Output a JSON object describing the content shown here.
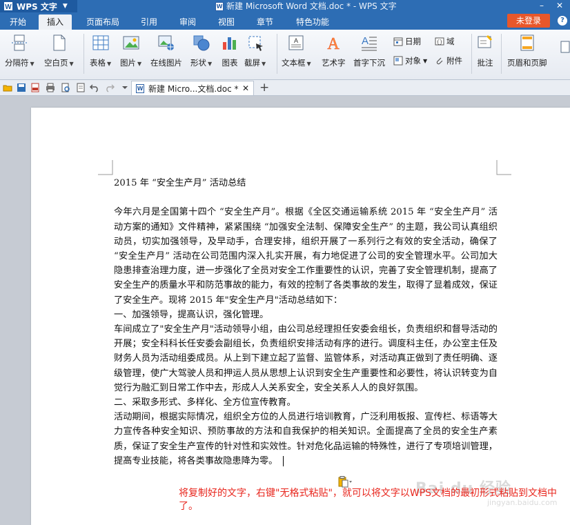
{
  "titlebar": {
    "app_menu": "WPS 文字",
    "document_title": "新建 Microsoft Word 文档.doc * - WPS 文字"
  },
  "menu": {
    "tabs": [
      "开始",
      "插入",
      "页面布局",
      "引用",
      "审阅",
      "视图",
      "章节",
      "特色功能"
    ],
    "active_tab": "插入",
    "login_button": "未登录"
  },
  "ribbon": {
    "buttons": [
      {
        "label": "分隔符",
        "icon": "page-break-icon",
        "dropdown": true
      },
      {
        "label": "空白页",
        "icon": "blank-page-icon",
        "dropdown": true
      },
      {
        "label": "表格",
        "icon": "table-icon",
        "dropdown": true
      },
      {
        "label": "图片",
        "icon": "picture-icon",
        "dropdown": true
      },
      {
        "label": "在线图片",
        "icon": "online-picture-icon",
        "dropdown": false
      },
      {
        "label": "形状",
        "icon": "shapes-icon",
        "dropdown": true
      },
      {
        "label": "图表",
        "icon": "chart-icon",
        "dropdown": false
      },
      {
        "label": "截屏",
        "icon": "screenshot-icon",
        "dropdown": true
      },
      {
        "label": "文本框",
        "icon": "textbox-icon",
        "dropdown": true
      },
      {
        "label": "艺术字",
        "icon": "wordart-icon",
        "dropdown": false
      },
      {
        "label": "首字下沉",
        "icon": "drop-cap-icon",
        "dropdown": false
      },
      {
        "label": "批注",
        "icon": "comment-icon",
        "dropdown": false
      },
      {
        "label": "页眉和页脚",
        "icon": "header-footer-icon",
        "dropdown": false
      }
    ],
    "small_buttons": [
      {
        "label": "日期",
        "icon": "date-icon"
      },
      {
        "label": "域",
        "icon": "field-icon"
      },
      {
        "label": "对象",
        "icon": "object-icon"
      },
      {
        "label": "附件",
        "icon": "attachment-icon"
      }
    ]
  },
  "doc_tab": {
    "label": "新建 Micro...文档.doc *"
  },
  "document": {
    "title": "2015 年 “安全生产月” 活动总结",
    "paragraphs": [
      "今年六月是全国第十四个 “安全生产月”。根据《全区交通运输系统 2015 年 “安全生产月” 活动方案的通知》文件精神，紧紧围绕 “加强安全法制、保障安全生产” 的主题，我公司认真组织动员，切实加强领导，及早动手，合理安排，组织开展了一系列行之有效的安全活动，确保了 “安全生产月” 活动在公司范围内深入扎实开展，有力地促进了公司的安全管理水平。公司加大隐患排查治理力度，进一步强化了全员对安全工作重要性的认识，完善了安全管理机制，提高了安全生产的质量水平和防范事故的能力，有效的控制了各类事故的发生，取得了显着成效，保证了安全生产。现将 2015 年\"安全生产月\"活动总结如下：",
      "一、加强领导，提高认识，强化管理。",
      "车间成立了\"安全生产月\"活动领导小组，由公司总经理担任安委会组长，负责组织和督导活动的开展；安全科科长任安委会副组长，负责组织安排活动有序的进行。调度科主任，办公室主任及财务人员为活动组委成员。从上到下建立起了监督、监管体系，对活动真正做到了责任明确、逐级管理，使广大驾驶人员和押运人员从思想上认识到安全生产重要性和必要性，将认识转变为自觉行为融汇到日常工作中去，形成人人关系安全，安全关系人人的良好氛围。",
      "二、采取多形式、多样化、全方位宣传教育。",
      "活动期间，根据实际情况，组织全方位的人员进行培训教育，广泛利用板报、宣传栏、标语等大力宣传各种安全知识、预防事故的方法和自我保护的相关知识。全面提高了全员的安全生产素质，保证了安全生产宣传的针对性和实效性。针对危化品运输的特殊性，进行了专项培训管理，提高专业技能，将各类事故隐患降为零。"
    ]
  },
  "annotation": "将复制好的文字，右键\"无格式粘贴\"，就可以将文字以WPS文档的最初形式粘贴到文档中了。",
  "watermark": {
    "line1": "Bai du 经验",
    "line2": "jingyan.baidu.com"
  },
  "colors": {
    "title_bar": "#2d6db4",
    "login_button": "#e8572a",
    "annotation_text": "#e8261d"
  }
}
